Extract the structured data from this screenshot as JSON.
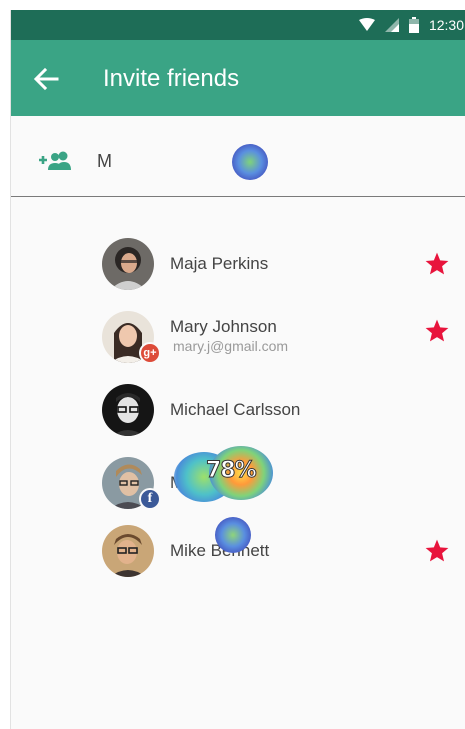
{
  "status_bar": {
    "time": "12:30",
    "icons": [
      "wifi-icon",
      "signal-icon",
      "battery-icon"
    ]
  },
  "app_bar": {
    "title": "Invite friends",
    "back_icon": "arrow-left-icon"
  },
  "search": {
    "value": "M",
    "icon": "add-person-icon"
  },
  "contacts": [
    {
      "name": "Maja Perkins",
      "email": "",
      "badge": "",
      "starred": true
    },
    {
      "name": "Mary Johnson",
      "email": "mary.j@gmail.com",
      "badge": "google-plus",
      "starred": true
    },
    {
      "name": "Michael Carlsson",
      "email": "",
      "badge": "",
      "starred": false
    },
    {
      "name": "Mike Allen",
      "email": "",
      "badge": "facebook",
      "starred": false
    },
    {
      "name": "Mike Bennett",
      "email": "",
      "badge": "",
      "starred": true
    }
  ],
  "heatmap": {
    "percent_label": "78%"
  },
  "colors": {
    "status_bar": "#1e6d57",
    "app_bar": "#3aa485",
    "accent": "#3aa485",
    "star": "#e8143c"
  }
}
